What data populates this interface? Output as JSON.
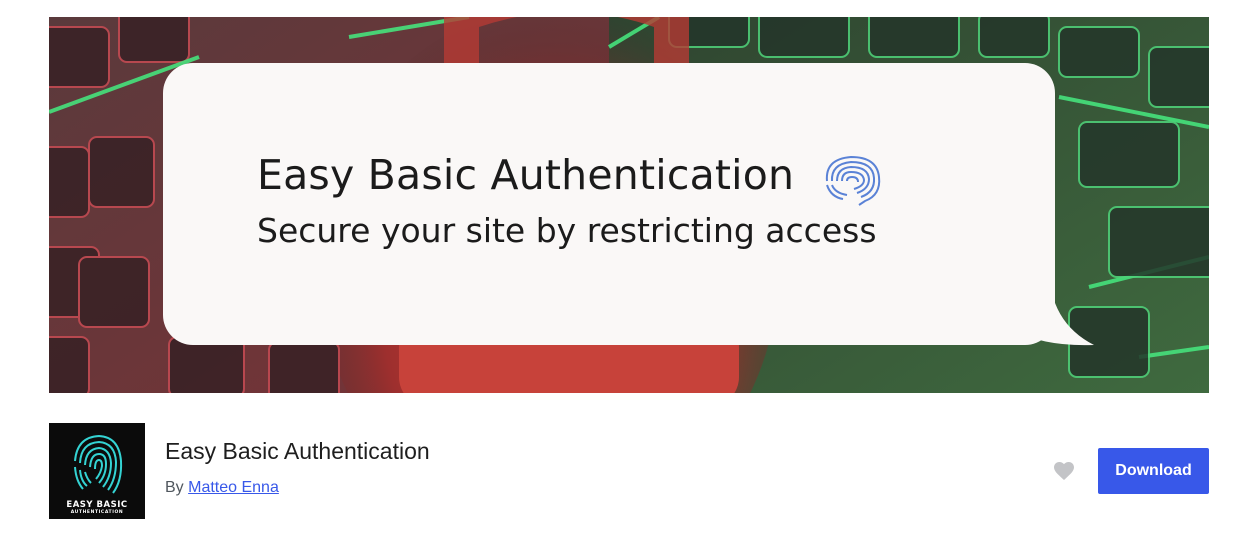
{
  "banner": {
    "title": "Easy Basic Authentication",
    "subtitle": "Secure your site by restricting access",
    "brain_icon": "fingerprint-brain-icon"
  },
  "plugin": {
    "icon_text_line1": "EASY BASIC",
    "icon_text_line2": "AUTHENTICATION",
    "icon": "fingerprint-icon",
    "title": "Easy Basic Authentication",
    "by_label": "By",
    "author": "Matteo Enna"
  },
  "actions": {
    "favorite_icon": "heart-icon",
    "download_label": "Download"
  },
  "colors": {
    "accent": "#3858e9",
    "fingerprint": "#34d3d3",
    "keyboard_green": "#3df07a",
    "lock_red": "#d9473f"
  }
}
